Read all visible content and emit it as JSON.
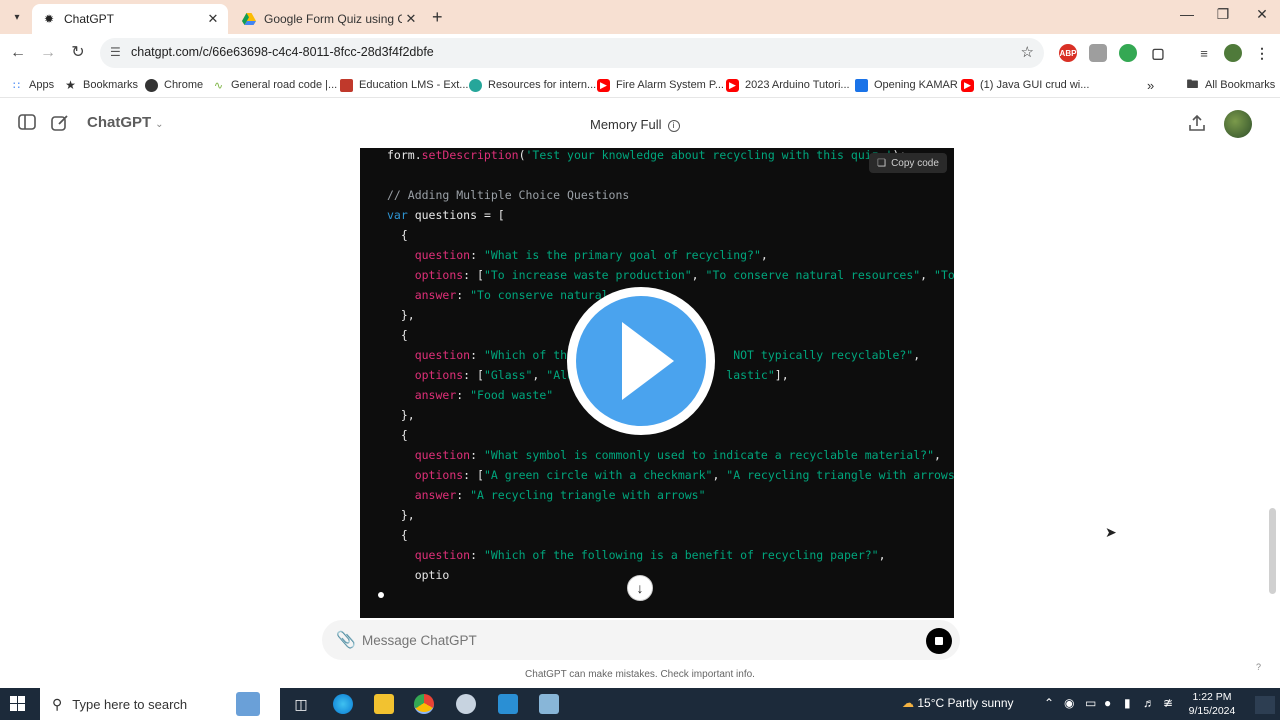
{
  "browser": {
    "tabs": [
      {
        "title": "ChatGPT",
        "icon": "chatgpt-icon",
        "active": true
      },
      {
        "title": "Google Form Quiz using Chatg",
        "icon": "google-drive-icon",
        "active": false
      }
    ],
    "url": "chatgpt.com/c/66e63698-c4c4-8011-8fcc-28d3f4f2dbfe",
    "bookmarks": [
      {
        "label": "Apps",
        "icon": "apps-grid-icon",
        "color": "#4285f4"
      },
      {
        "label": "Bookmarks",
        "icon": "star-icon",
        "color": "#333333"
      },
      {
        "label": "Chrome",
        "icon": "chrome-icon",
        "color": "#333333"
      },
      {
        "label": "General road code |...",
        "icon": "road-icon",
        "color": "#7cb342"
      },
      {
        "label": "Education LMS - Ext...",
        "icon": "lms-icon",
        "color": "#c0392b"
      },
      {
        "label": "Resources for intern...",
        "icon": "resources-icon",
        "color": "#26a69a"
      },
      {
        "label": "Fire Alarm System P...",
        "icon": "youtube-icon",
        "color": "#ff0000"
      },
      {
        "label": "2023 Arduino Tutori...",
        "icon": "youtube-icon",
        "color": "#ff0000"
      },
      {
        "label": "Opening KAMAR",
        "icon": "kamar-icon",
        "color": "#1a73e8"
      },
      {
        "label": "(1) Java GUI crud wi...",
        "icon": "youtube-icon",
        "color": "#ff0000"
      }
    ],
    "all_bookmarks": "All Bookmarks"
  },
  "chatgpt": {
    "model": "ChatGPT",
    "memory": "Memory Full",
    "copy_code": "Copy code",
    "composer_placeholder": "Message ChatGPT",
    "disclaimer": "ChatGPT can make mistakes. Check important info.",
    "help": "?"
  },
  "code_lines": [
    {
      "text": "form.setDescription('Test your knowledge about recycling with this quiz.');"
    },
    {
      "text": ""
    },
    {
      "text": "// Adding Multiple Choice Questions"
    },
    {
      "text": "var questions = ["
    },
    {
      "text": "  {"
    },
    {
      "text": "    question: \"What is the primary goal of recycling?\","
    },
    {
      "text": "    options: [\"To increase waste production\", \"To conserve natural resources\", \"To incre"
    },
    {
      "text": "    answer: \"To conserve natural re"
    },
    {
      "text": "  },"
    },
    {
      "text": "  {"
    },
    {
      "text": "    question: \"Which of the                       NOT typically recyclable?\","
    },
    {
      "text": "    options: [\"Glass\", \"Alum                     lastic\"],"
    },
    {
      "text": "    answer: \"Food waste\""
    },
    {
      "text": "  },"
    },
    {
      "text": "  {"
    },
    {
      "text": "    question: \"What symbol is commonly used to indicate a recyclable material?\","
    },
    {
      "text": "    options: [\"A green circle with a checkmark\", \"A recycling triangle with arrows\", \"A"
    },
    {
      "text": "    answer: \"A recycling triangle with arrows\""
    },
    {
      "text": "  },"
    },
    {
      "text": "  {"
    },
    {
      "text": "    question: \"Which of the following is a benefit of recycling paper?\","
    },
    {
      "text": "    optio"
    }
  ],
  "taskbar": {
    "search_placeholder": "Type here to search",
    "weather": "15°C  Partly sunny",
    "time": "1:22 PM",
    "date": "9/15/2024"
  },
  "colors": {
    "tab_strip": "#f7e0d2",
    "code_bg": "#0d0d0d",
    "play_button": "#4aa3ee",
    "taskbar": "#1c2a3a"
  }
}
